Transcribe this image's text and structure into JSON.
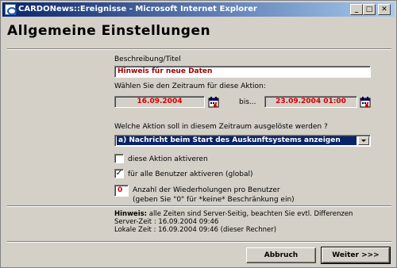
{
  "window": {
    "title": "CARDONews::Ereignisse - Microsoft Internet Explorer",
    "minimize_glyph": "_",
    "maximize_glyph": "□",
    "close_glyph": "✕"
  },
  "page": {
    "title": "Allgemeine Einstellungen"
  },
  "form": {
    "description_label": "Beschreibung/Titel",
    "description_value": "Hinweis für neue Daten",
    "period_label": "Wählen Sie den Zeitraum für diese Aktion:",
    "date_from": "16.09.2004",
    "date_to_label": "bis...",
    "date_to": "23.09.2004 01:00",
    "action_label": "Welche Aktion soll in diesem Zeitraum ausgelöste werden ?",
    "action_selected": "a) Nachricht beim Start des Auskunftsystems anzeigen",
    "check_activate_label": "diese Aktion aktiveren",
    "check_activate_checked": false,
    "check_all_users_label": "für alle Benutzer aktiveren (global)",
    "check_all_users_checked": true,
    "check_mark": "✓",
    "repeat_value": "0",
    "repeat_label_line1": "Anzahl der Wiederholungen pro Benutzer",
    "repeat_label_line2": "(geben Sie \"0\" für *keine* Beschränkung ein)"
  },
  "info": {
    "hint_label": "Hinweis:",
    "hint_text": " alle Zeiten sind Server-Seitig, beachten Sie evtl. Differenzen",
    "server_time": "Server-Zeit : 16.09.2004 09:46",
    "local_time": "Lokale Zeit : 16.09.2004 09:46 (dieser Rechner)"
  },
  "buttons": {
    "cancel": "Abbruch",
    "next": "Weiter >>>"
  },
  "icons": {
    "calendar": "calendar-icon",
    "app": "ie-icon"
  },
  "colors": {
    "title_bar_start": "#0a246a",
    "input_value_text": "#a00000",
    "date_text": "#d00000",
    "selection_bg": "#0a246a"
  }
}
